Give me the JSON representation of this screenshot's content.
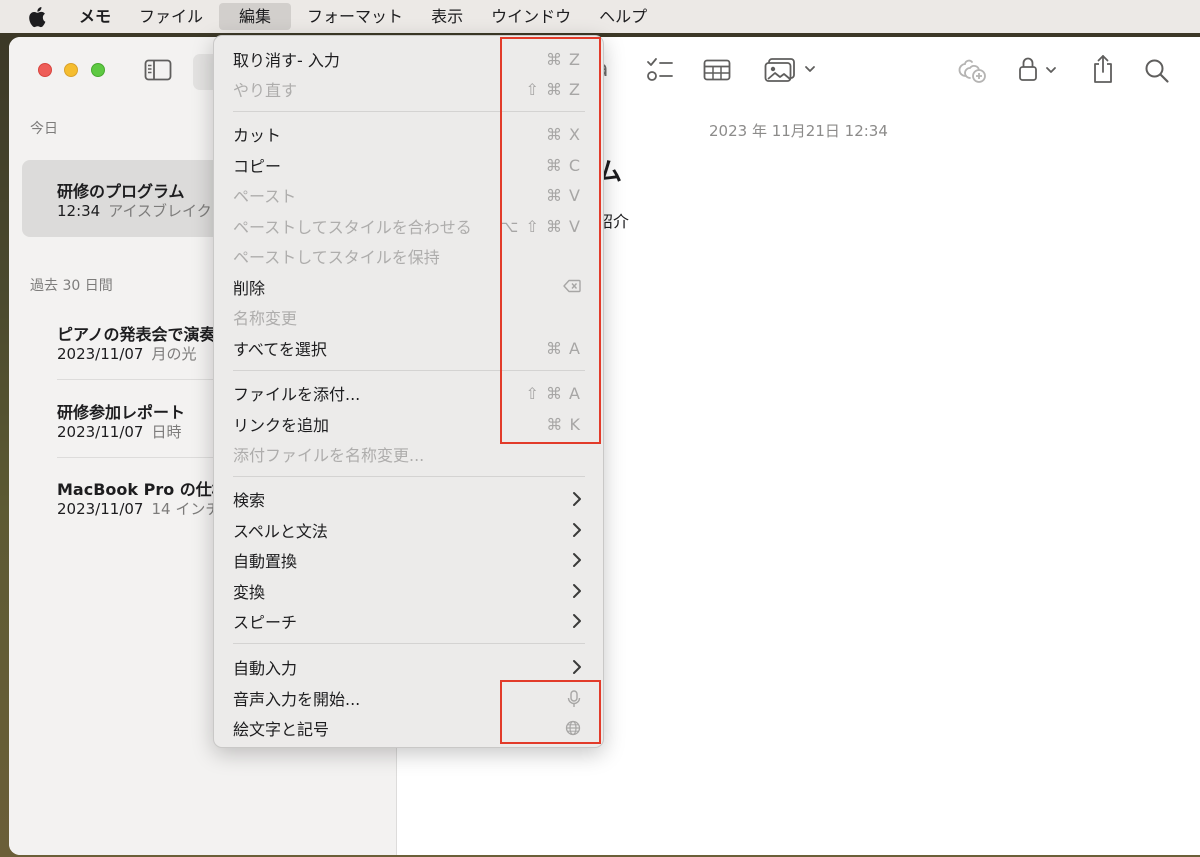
{
  "menubar": {
    "app": "メモ",
    "items": [
      "ファイル",
      "編集",
      "フォーマット",
      "表示",
      "ウインドウ",
      "ヘルプ"
    ],
    "active_index": 1
  },
  "sidebar": {
    "today_header": "今日",
    "past_header": "過去 30 日間",
    "selected_note": {
      "title": "研修のプログラム",
      "time": "12:34",
      "preview": "アイスブレイク"
    },
    "notes": [
      {
        "title": "ピアノの発表会で演奏",
        "date": "2023/11/07",
        "preview": "月の光"
      },
      {
        "title": "研修参加レポート",
        "date": "2023/11/07",
        "preview": "日時"
      },
      {
        "title": "MacBook Pro の仕様",
        "date": "2023/11/07",
        "preview": "14 インチ"
      }
    ]
  },
  "editor": {
    "date": "2023 年 11月21日 12:34",
    "title_fragment": "ム",
    "body_fragment": "紹介",
    "aa": "a"
  },
  "menu": {
    "items": [
      {
        "label": "取り消す- 入力",
        "shortcut": "⌘ Z",
        "disabled": false
      },
      {
        "label": "やり直す",
        "shortcut": "⇧ ⌘ Z",
        "disabled": true
      },
      {
        "label": "カット",
        "shortcut": "⌘ X",
        "disabled": false
      },
      {
        "label": "コピー",
        "shortcut": "⌘ C",
        "disabled": false
      },
      {
        "label": "ペースト",
        "shortcut": "⌘ V",
        "disabled": true
      },
      {
        "label": "ペーストしてスタイルを合わせる",
        "shortcut": "⌥ ⇧ ⌘ V",
        "disabled": true
      },
      {
        "label": "ペーストしてスタイルを保持",
        "shortcut": "",
        "disabled": true
      },
      {
        "label": "削除",
        "shortcut_icon": "delete-key-icon",
        "disabled": false
      },
      {
        "label": "名称変更",
        "shortcut": "",
        "disabled": true
      },
      {
        "label": "すべてを選択",
        "shortcut": "⌘ A",
        "disabled": false
      },
      {
        "label": "ファイルを添付...",
        "shortcut": "⇧ ⌘ A",
        "disabled": false
      },
      {
        "label": "リンクを追加",
        "shortcut": "⌘ K",
        "disabled": false
      },
      {
        "label": "添付ファイルを名称変更...",
        "shortcut": "",
        "disabled": true
      },
      {
        "label": "検索",
        "submenu": true
      },
      {
        "label": "スペルと文法",
        "submenu": true
      },
      {
        "label": "自動置換",
        "submenu": true
      },
      {
        "label": "変換",
        "submenu": true
      },
      {
        "label": "スピーチ",
        "submenu": true
      },
      {
        "label": "自動入力",
        "submenu": true
      },
      {
        "label": "音声入力を開始...",
        "shortcut_icon": "microphone-icon"
      },
      {
        "label": "絵文字と記号",
        "shortcut_icon": "globe-icon"
      }
    ]
  },
  "colors": {
    "highlight": "#e23b2a",
    "menubar_bg": "#ece9e6",
    "menu_bg": "#ecebea"
  }
}
